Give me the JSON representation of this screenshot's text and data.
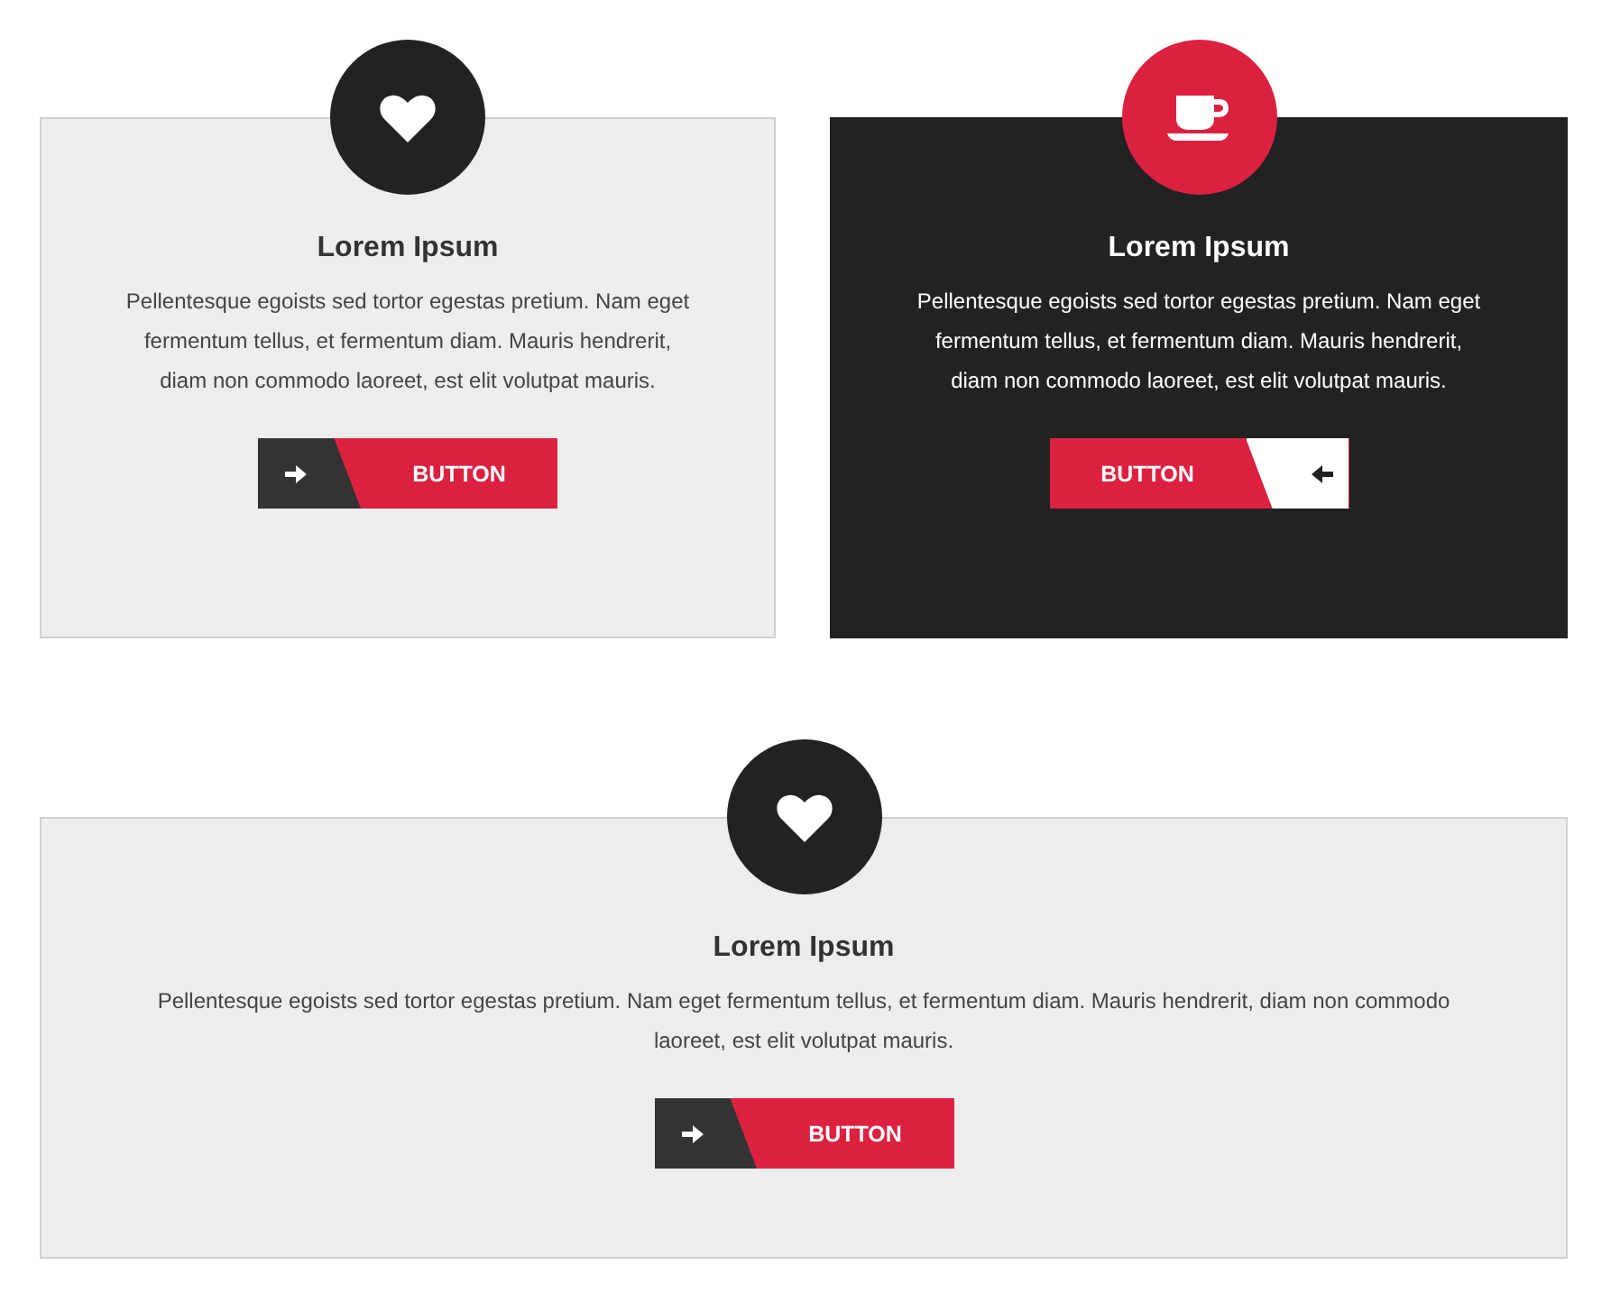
{
  "cards": [
    {
      "kind": "light",
      "title": "Lorem Ipsum",
      "text": "Pellentesque egoists sed tortor egestas pretium. Nam eget fermentum tellus, et fermentum diam. Mauris hendrerit, diam non commodo laoreet, est elit volutpat mauris.",
      "button": {
        "label": "BUTTON",
        "kind": "leading"
      }
    },
    {
      "kind": "dark",
      "title": "Lorem Ipsum",
      "text": "Pellentesque egoists sed tortor egestas pretium. Nam eget fermentum tellus, et fermentum diam. Mauris hendrerit, diam non commodo laoreet, est elit volutpat mauris.",
      "button": {
        "label": "BUTTON",
        "kind": "trailing"
      }
    },
    {
      "kind": "light",
      "title": "Lorem Ipsum",
      "text": "Pellentesque egoists sed tortor egestas pretium. Nam eget fermentum tellus, et fermentum diam. Mauris hendrerit, diam non commodo laoreet, est elit volutpat mauris.",
      "button": {
        "label": "BUTTON",
        "kind": "leading"
      }
    }
  ]
}
